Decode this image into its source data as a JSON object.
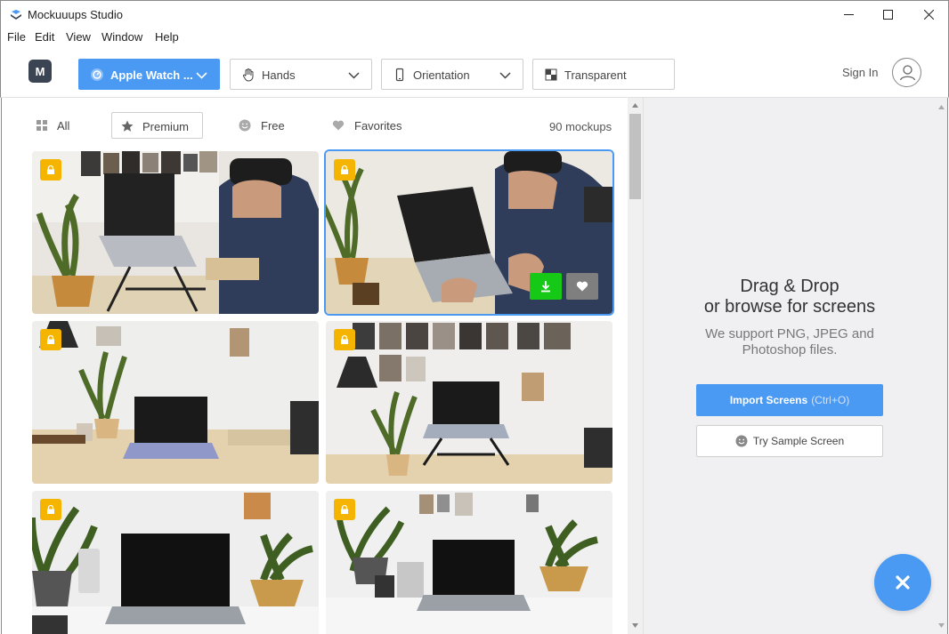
{
  "window": {
    "title": "Mockuuups Studio"
  },
  "menu": [
    "File",
    "Edit",
    "Window",
    "Help",
    "View"
  ],
  "menu_items": {
    "file": "File",
    "edit": "Edit",
    "view": "View",
    "window": "Window",
    "help": "Help"
  },
  "toolbar": {
    "logo": "M",
    "device": "Apple Watch ...",
    "hands": "Hands",
    "orientation": "Orientation",
    "background": "Transparent",
    "sign_in": "Sign In"
  },
  "filters": {
    "all": "All",
    "premium": "Premium",
    "free": "Free",
    "favorites": "Favorites",
    "count": "90 mockups"
  },
  "thumbnails": [
    {
      "name": "laptop-stand-man-plaid",
      "premium": true
    },
    {
      "name": "man-typing-laptop",
      "premium": true,
      "selected": true
    },
    {
      "name": "laptop-desk-plant-lamp",
      "premium": true
    },
    {
      "name": "laptop-stand-wall-photos",
      "premium": true
    },
    {
      "name": "laptop-desk-plants-left",
      "premium": true
    },
    {
      "name": "laptop-desk-plants-right",
      "premium": true
    }
  ],
  "dropzone": {
    "title_line1": "Drag & Drop",
    "title_line2": "or browse for screens",
    "sub_line1": "We support PNG, JPEG and",
    "sub_line2": "Photoshop files.",
    "import_label": "Import Screens",
    "import_hint": "(Ctrl+O)",
    "sample_label": "Try Sample Screen"
  },
  "colors": {
    "accent": "#4a9af4",
    "lock": "#f5b400",
    "download": "#17c917",
    "panel_bg": "#f0f0f3"
  }
}
